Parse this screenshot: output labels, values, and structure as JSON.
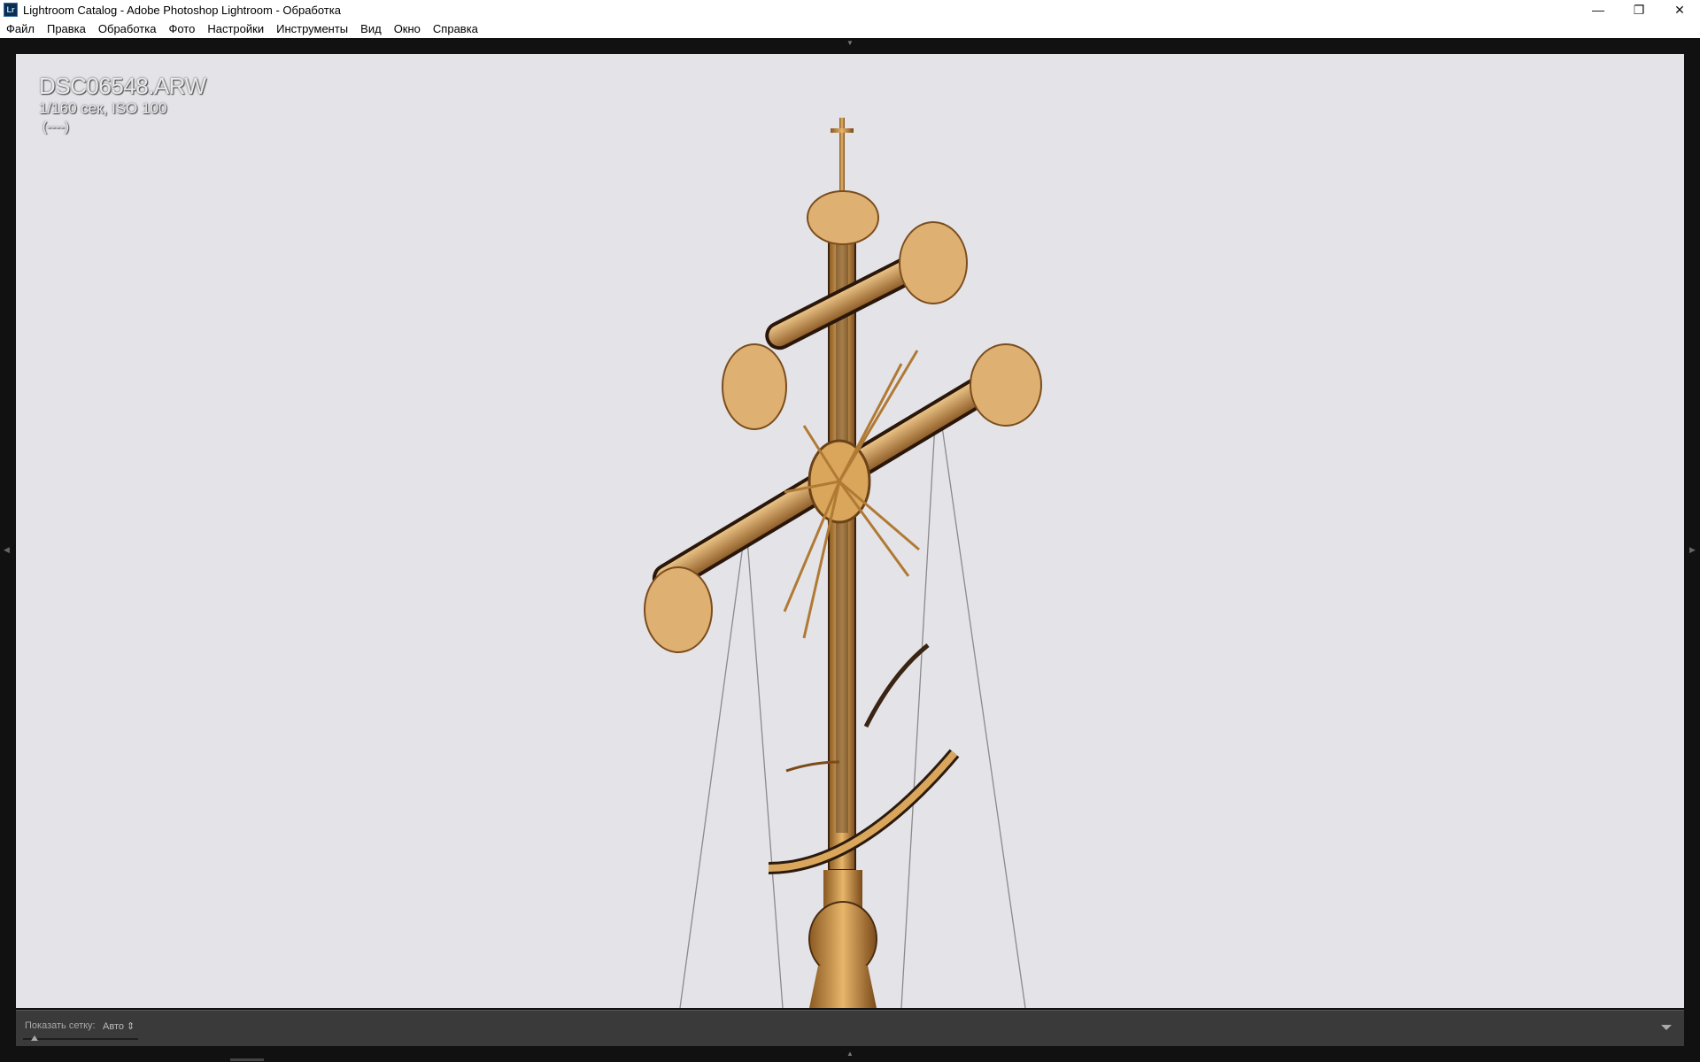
{
  "window": {
    "title": "Lightroom Catalog - Adobe Photoshop Lightroom - Обработка",
    "app_icon": "Lr",
    "controls": [
      "minimize",
      "restore",
      "close"
    ]
  },
  "menu": {
    "items": [
      "Файл",
      "Правка",
      "Обработка",
      "Фото",
      "Настройки",
      "Инструменты",
      "Вид",
      "Окно",
      "Справка"
    ]
  },
  "photo": {
    "filename": "DSC06548.ARW",
    "exposure": "1/160 сек, ISO 100",
    "rating": "(----)"
  },
  "toolbar": {
    "grid_label": "Показать сетку:",
    "grid_value": "Авто ⇕",
    "slider_level": 0.1
  }
}
